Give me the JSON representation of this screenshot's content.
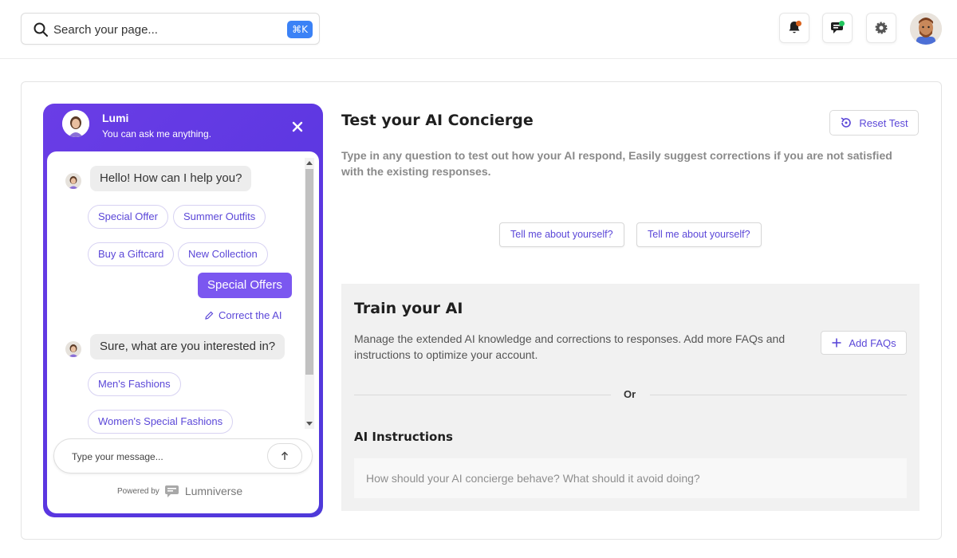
{
  "topbar": {
    "search": {
      "placeholder": "Search your page...",
      "shortcut": "⌘K"
    },
    "notification_dot_color": "#d9621c",
    "messages_dot_color": "#22c55e",
    "icons": [
      "bell-icon",
      "messages-icon",
      "settings-icon",
      "user-avatar"
    ]
  },
  "chat": {
    "bot_name": "Lumi",
    "bot_subtitle": "You can ask me anything.",
    "messages": {
      "greeting": "Hello! How can I help you?",
      "quick_replies_1": [
        "Special Offer",
        "Summer Outfits",
        "Buy a Giftcard",
        "New Collection"
      ],
      "user_message": "Special Offers",
      "correct_label": "Correct the AI",
      "followup": "Sure, what are you interested in?",
      "quick_replies_2": [
        "Men's Fashions",
        "Women's Special Fashions"
      ]
    },
    "input_placeholder": "Type your message...",
    "powered_by": "Powered by",
    "brand": "Lumniverse",
    "accent_color": "#6a3de6"
  },
  "test_panel": {
    "title": "Test your AI Concierge",
    "reset_label": "Reset Test",
    "description": "Type in any question to test out how your AI respond, Easily suggest corrections if you are not satisfied with the existing responses.",
    "suggestions": [
      "Tell me about yourself?",
      "Tell me about yourself?"
    ]
  },
  "train_panel": {
    "title": "Train your AI",
    "description": "Manage the extended AI knowledge and corrections to responses. Add more FAQs and instructions to optimize your account.",
    "add_label": "Add FAQs",
    "or_label": "Or",
    "instructions_title": "AI Instructions",
    "instructions_placeholder": "How should your AI concierge behave? What should it avoid doing?"
  }
}
